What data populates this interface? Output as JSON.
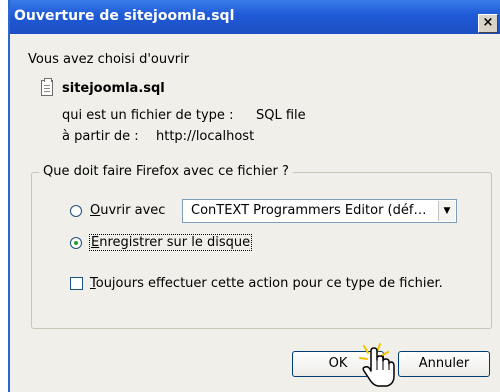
{
  "window": {
    "title": "Ouverture de sitejoomla.sql",
    "close_glyph": "×"
  },
  "intro_text": "Vous avez choisi d'ouvrir",
  "file": {
    "icon": "file-icon",
    "name": "sitejoomla.sql",
    "type_label": "qui est un fichier de type :",
    "type_value": "SQL file",
    "source_label": "à partir de :",
    "source_value": "http://localhost"
  },
  "action_group": {
    "legend": "Que doit faire Firefox avec ce fichier ?",
    "open_with": {
      "label_first_char": "O",
      "label_rest": "uvrir avec",
      "selected": false,
      "app_value": "ConTEXT Programmers Editor (déf…"
    },
    "save_to_disk": {
      "label_first_char": "E",
      "label_rest": "nregistrer sur le disque",
      "selected": true
    }
  },
  "always_do": {
    "label_first_char": "T",
    "label_rest": "oujours effectuer cette action pour ce type de fichier.",
    "checked": false
  },
  "buttons": {
    "ok": "OK",
    "cancel": "Annuler"
  },
  "colors": {
    "titlebar": "#1f5ad6",
    "dialog_bg": "#f0efe9",
    "button_border": "#003c74"
  }
}
